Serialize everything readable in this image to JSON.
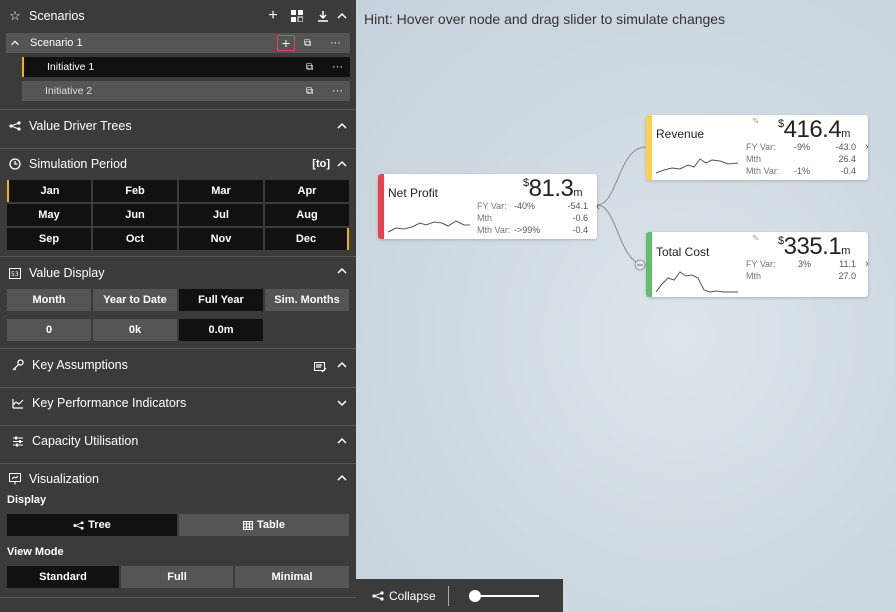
{
  "sidebar": {
    "scenarios": {
      "title": "Scenarios",
      "scenario_name": "Scenario 1",
      "initiatives": [
        "Initiative 1",
        "Initiative 2"
      ]
    },
    "value_driver_trees": {
      "title": "Value Driver Trees"
    },
    "simulation_period": {
      "title": "Simulation Period",
      "badge": "[to]",
      "months": [
        "Jan",
        "Feb",
        "Mar",
        "Apr",
        "May",
        "Jun",
        "Jul",
        "Aug",
        "Sep",
        "Oct",
        "Nov",
        "Dec"
      ]
    },
    "value_display": {
      "title": "Value Display",
      "modes": [
        "Month",
        "Year to Date",
        "Full Year",
        "Sim. Months"
      ],
      "selected_mode": "Full Year",
      "formats": [
        "0",
        "0k",
        "0.0m"
      ],
      "selected_format": "0.0m"
    },
    "key_assumptions": {
      "title": "Key Assumptions"
    },
    "kpis": {
      "title": "Key Performance Indicators"
    },
    "capacity": {
      "title": "Capacity Utilisation"
    },
    "visualization": {
      "title": "Visualization",
      "display_label": "Display",
      "display_options": [
        "Tree",
        "Table"
      ],
      "selected_display": "Tree",
      "view_mode_label": "View Mode",
      "view_modes": [
        "Standard",
        "Full",
        "Minimal"
      ],
      "selected_view_mode": "Standard"
    }
  },
  "canvas": {
    "hint": "Hint: Hover over node and drag slider to simulate changes",
    "collapse_label": "Collapse",
    "nodes": {
      "net_profit": {
        "name": "Net Profit",
        "currency": "$",
        "value": "81.3",
        "unit": "m",
        "color": "#e8404c",
        "rows": [
          {
            "label": "FY Var:",
            "pct": "-40%",
            "val": "-54.1"
          },
          {
            "label": "Mth",
            "pct": "",
            "val": "-0.6"
          },
          {
            "label": "Mth Var:",
            "pct": "->99%",
            "val": "-0.4"
          }
        ]
      },
      "revenue": {
        "name": "Revenue",
        "currency": "$",
        "value": "416.4",
        "unit": "m",
        "color": "#ffd24d",
        "rows": [
          {
            "label": "FY Var:",
            "pct": "-9%",
            "val": "-43.0"
          },
          {
            "label": "Mth",
            "pct": "",
            "val": "26.4"
          },
          {
            "label": "Mth Var:",
            "pct": "-1%",
            "val": "-0.4"
          }
        ]
      },
      "total_cost": {
        "name": "Total Cost",
        "currency": "$",
        "value": "335.1",
        "unit": "m",
        "color": "#5fbf6e",
        "rows": [
          {
            "label": "FY Var:",
            "pct": "3%",
            "val": "11.1"
          },
          {
            "label": "Mth",
            "pct": "",
            "val": "27.0"
          }
        ]
      }
    }
  }
}
